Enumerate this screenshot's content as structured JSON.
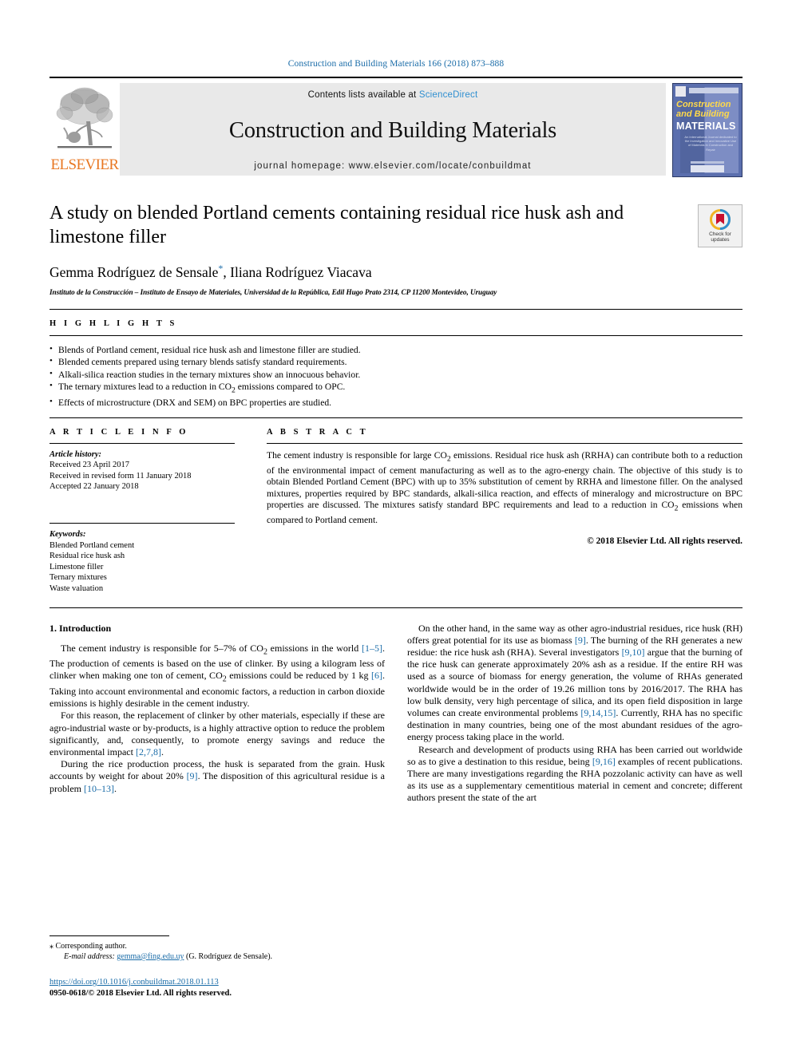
{
  "running_head": "Construction and Building Materials 166 (2018) 873–888",
  "masthead": {
    "publisher_wordmark": "ELSEVIER",
    "contents_prefix": "Contents lists available at ",
    "contents_link": "ScienceDirect",
    "journal_name": "Construction and Building Materials",
    "homepage_line": "journal homepage: www.elsevier.com/locate/conbuildmat",
    "cover": {
      "line1": "Construction",
      "line2": "and Building",
      "line3": "MATERIALS",
      "subtext": "An International Journal dedicated to the Investigation and Innovative Use of Materials in Construction and Repair"
    }
  },
  "article": {
    "title": "A study on blended Portland cements containing residual rice husk ash and limestone filler",
    "authors": "Gemma Rodríguez de Sensale",
    "author_star": "*",
    "authors_rest": ", Iliana Rodríguez Viacava",
    "affiliation": "Instituto de la Construcción – Instituto de Ensayo de Materiales, Universidad de la República, Edil Hugo Prato 2314, CP 11200 Montevideo, Uruguay",
    "crossmark_line1": "Check for",
    "crossmark_line2": "updates"
  },
  "highlights": {
    "label": "H I G H L I G H T S",
    "items": [
      "Blends of Portland cement, residual rice husk ash and limestone filler are studied.",
      "Blended cements prepared using ternary blends satisfy standard requirements.",
      "Alkali-silica reaction studies in the ternary mixtures show an innocuous behavior.",
      "The ternary mixtures lead to a reduction in CO2 emissions compared to OPC.",
      "Effects of microstructure (DRX and SEM) on BPC properties are studied."
    ]
  },
  "article_info": {
    "label": "A R T I C L E   I N F O",
    "history_label": "Article history:",
    "history": [
      "Received 23 April 2017",
      "Received in revised form 11 January 2018",
      "Accepted 22 January 2018"
    ],
    "keywords_label": "Keywords:",
    "keywords": [
      "Blended Portland cement",
      "Residual rice husk ash",
      "Limestone filler",
      "Ternary mixtures",
      "Waste valuation"
    ]
  },
  "abstract": {
    "label": "A B S T R A C T",
    "text": "The cement industry is responsible for large CO2 emissions. Residual rice husk ash (RRHA) can contribute both to a reduction of the environmental impact of cement manufacturing as well as to the agro-energy chain. The objective of this study is to obtain Blended Portland Cement (BPC) with up to 35% substitution of cement by RRHA and limestone filler. On the analysed mixtures, properties required by BPC standards, alkali-silica reaction, and effects of mineralogy and microstructure on BPC properties are discussed. The mixtures satisfy standard BPC requirements and lead to a reduction in CO2 emissions when compared to Portland cement.",
    "copyright": "© 2018 Elsevier Ltd. All rights reserved."
  },
  "body": {
    "section_heading": "1. Introduction",
    "left_paragraphs": [
      "The cement industry is responsible for 5–7% of CO2 emissions in the world [1–5]. The production of cements is based on the use of clinker. By using a kilogram less of clinker when making one ton of cement, CO2 emissions could be reduced by 1 kg [6]. Taking into account environmental and economic factors, a reduction in carbon dioxide emissions is highly desirable in the cement industry.",
      "For this reason, the replacement of clinker by other materials, especially if these are agro-industrial waste or by-products, is a highly attractive option to reduce the problem significantly, and, consequently, to promote energy savings and reduce the environmental impact [2,7,8].",
      "During the rice production process, the husk is separated from the grain. Husk accounts by weight for about 20% [9]. The disposition of this agricultural residue is a problem [10–13]."
    ],
    "right_paragraphs": [
      "On the other hand, in the same way as other agro-industrial residues, rice husk (RH) offers great potential for its use as biomass [9]. The burning of the RH generates a new residue: the rice husk ash (RHA). Several investigators [9,10] argue that the burning of the rice husk can generate approximately 20% ash as a residue. If the entire RH was used as a source of biomass for energy generation, the volume of RHAs generated worldwide would be in the order of 19.26 million tons by 2016/2017. The RHA has low bulk density, very high percentage of silica, and its open field disposition in large volumes can create environmental problems [9,14,15]. Currently, RHA has no specific destination in many countries, being one of the most abundant residues of the agro-energy process taking place in the world.",
      "Research and development of products using RHA has been carried out worldwide so as to give a destination to this residue, being [9,16] examples of recent publications. There are many investigations regarding the RHA pozzolanic activity can have as well as its use as a supplementary cementitious material in cement and concrete; different authors present the state of the art"
    ]
  },
  "footnotes": {
    "corresponding_star": "⁎",
    "corresponding_text": "Corresponding author.",
    "email_label": "E-mail address:",
    "email": "gemma@fing.edu.uy",
    "email_owner": "(G. Rodríguez de Sensale).",
    "doi": "https://doi.org/10.1016/j.conbuildmat.2018.01.113",
    "issn_line": "0950-0618/© 2018 Elsevier Ltd. All rights reserved."
  },
  "colors": {
    "link_blue": "#1a6ca8",
    "sciencedirect_blue": "#2f8fd0",
    "elsevier_orange": "#e87722",
    "band_gray": "#e9e9e9"
  }
}
